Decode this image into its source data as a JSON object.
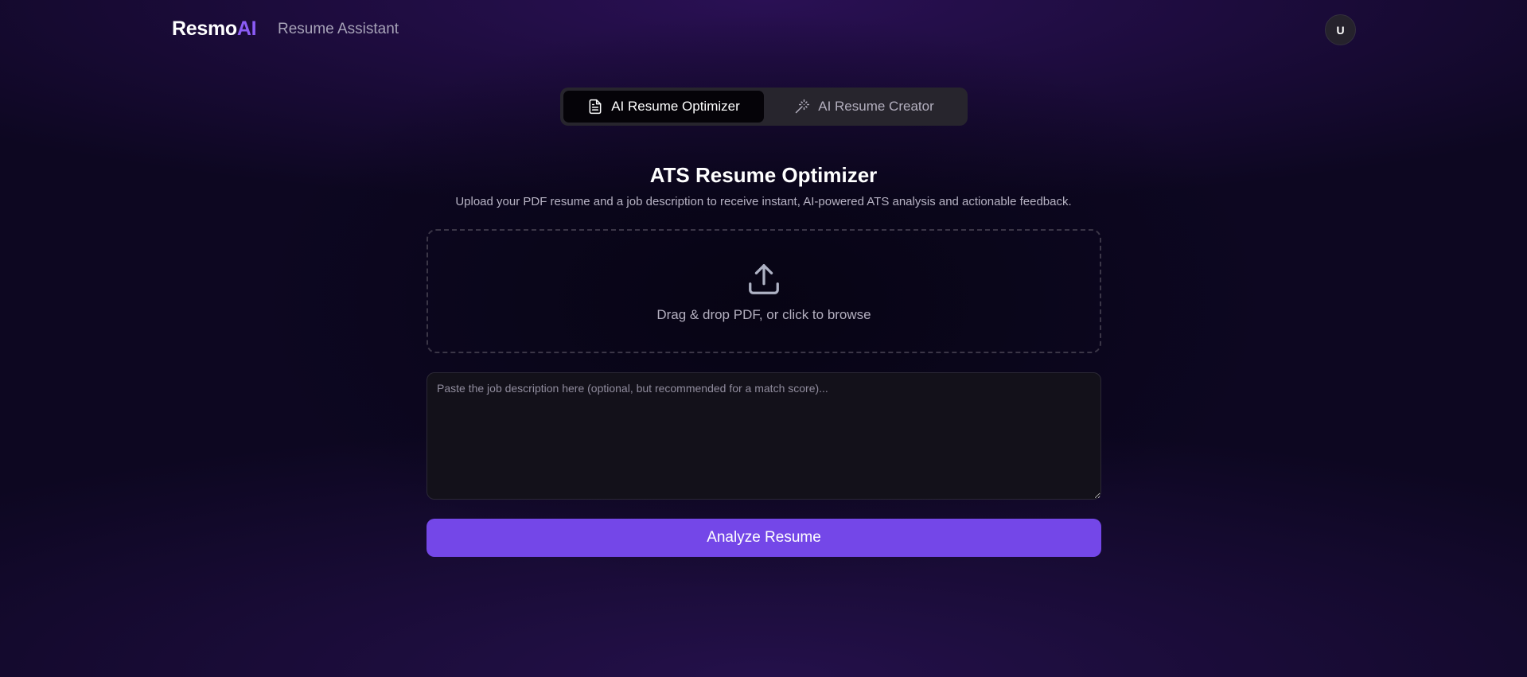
{
  "header": {
    "logo_main": "Resmo",
    "logo_accent": "AI",
    "subtitle": "Resume Assistant",
    "avatar_initial": "U"
  },
  "tabs": [
    {
      "label": "AI Resume Optimizer",
      "icon": "document-icon",
      "active": true
    },
    {
      "label": "AI Resume Creator",
      "icon": "magic-wand-icon",
      "active": false
    }
  ],
  "main": {
    "title": "ATS Resume Optimizer",
    "description": "Upload your PDF resume and a job description to receive instant, AI-powered ATS analysis and actionable feedback.",
    "dropzone": {
      "icon": "upload-icon",
      "text": "Drag & drop PDF, or click to browse"
    },
    "job_description": {
      "value": "",
      "placeholder": "Paste the job description here (optional, but recommended for a match score)..."
    },
    "analyze_label": "Analyze Resume"
  },
  "colors": {
    "accent": "#8b5cf6",
    "button": "#7447e8",
    "background": "#0d0721"
  }
}
